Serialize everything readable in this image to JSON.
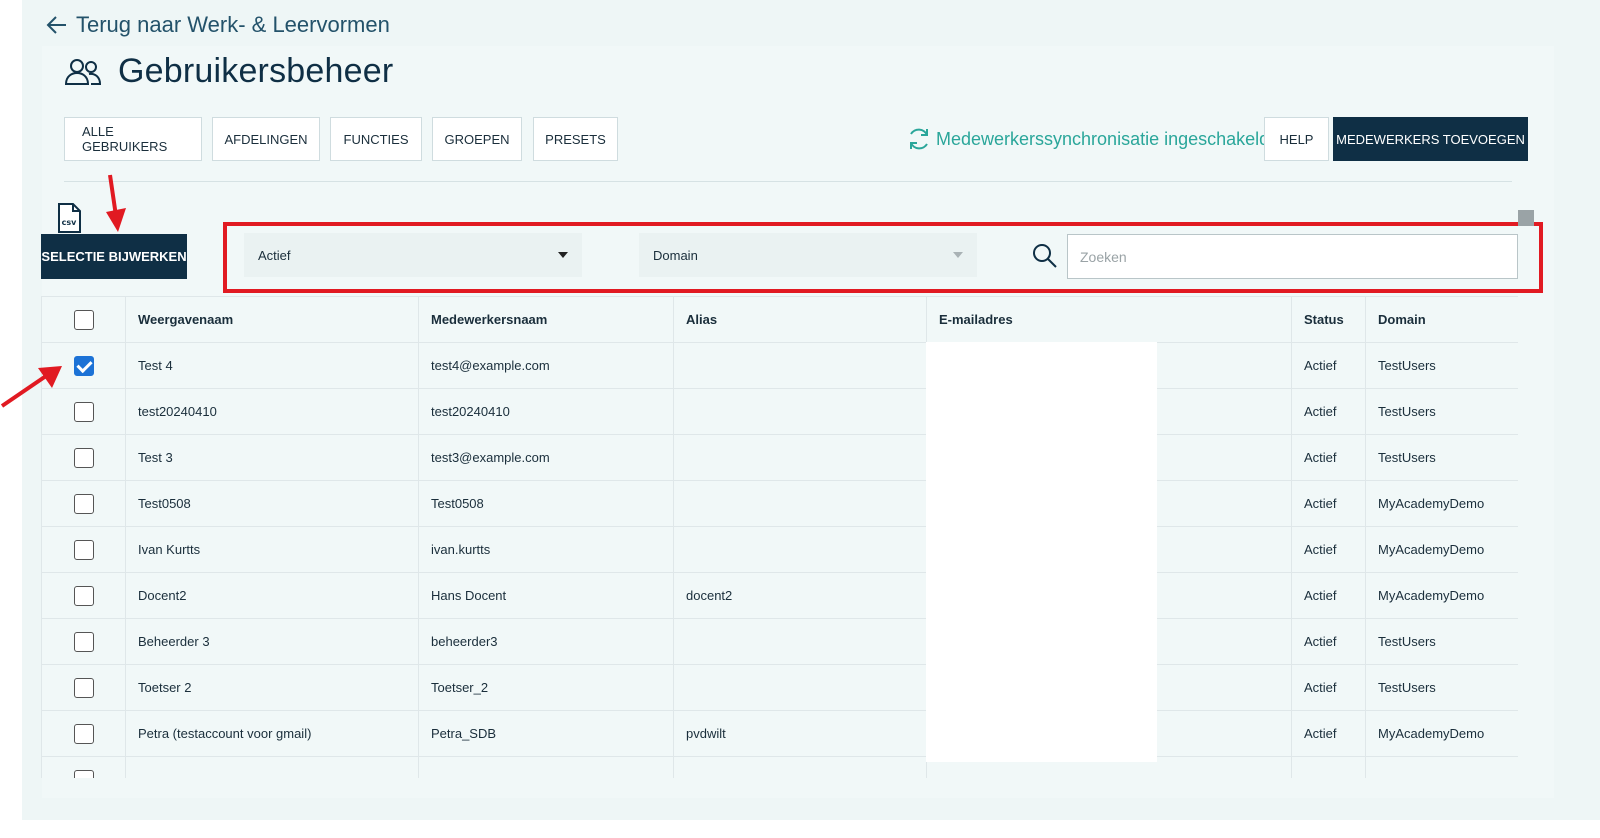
{
  "header": {
    "back_label": "Terug naar Werk- & Leervormen",
    "title": "Gebruikersbeheer"
  },
  "tabs": [
    {
      "label": "ALLE GEBRUIKERS"
    },
    {
      "label": "AFDELINGEN"
    },
    {
      "label": "FUNCTIES"
    },
    {
      "label": "GROEPEN"
    },
    {
      "label": "PRESETS"
    }
  ],
  "sync": {
    "label": "Medewerkerssynchronisatie ingeschakeld",
    "color": "#2aa69a"
  },
  "actions": {
    "help_label": "HELP",
    "add_label": "MEDEWERKERS TOEVOEGEN",
    "selectie_label": "SELECTIE BIJWERKEN",
    "csv_icon_text": "csv"
  },
  "filters": {
    "status_value": "Actief",
    "domain_value": "Domain",
    "search_placeholder": "Zoeken"
  },
  "table": {
    "columns": [
      "Weergavenaam",
      "Medewerkersnaam",
      "Alias",
      "E-mailadres",
      "Status",
      "Domain"
    ],
    "rows": [
      {
        "checked": true,
        "name": "Test 4",
        "user": "test4@example.com",
        "alias": "",
        "status": "Actief",
        "domain": "TestUsers"
      },
      {
        "checked": false,
        "name": "test20240410",
        "user": "test20240410",
        "alias": "",
        "status": "Actief",
        "domain": "TestUsers"
      },
      {
        "checked": false,
        "name": "Test 3",
        "user": "test3@example.com",
        "alias": "",
        "status": "Actief",
        "domain": "TestUsers"
      },
      {
        "checked": false,
        "name": "Test0508",
        "user": "Test0508",
        "alias": "",
        "status": "Actief",
        "domain": "MyAcademyDemo"
      },
      {
        "checked": false,
        "name": "Ivan Kurtts",
        "user": "ivan.kurtts",
        "alias": "",
        "status": "Actief",
        "domain": "MyAcademyDemo"
      },
      {
        "checked": false,
        "name": "Docent2",
        "user": "Hans Docent",
        "alias": "docent2",
        "status": "Actief",
        "domain": "MyAcademyDemo"
      },
      {
        "checked": false,
        "name": "Beheerder 3",
        "user": "beheerder3",
        "alias": "",
        "status": "Actief",
        "domain": "TestUsers"
      },
      {
        "checked": false,
        "name": "Toetser 2",
        "user": "Toetser_2",
        "alias": "",
        "status": "Actief",
        "domain": "TestUsers"
      },
      {
        "checked": false,
        "name": "Petra (testaccount voor gmail)",
        "user": "Petra_SDB",
        "alias": "pvdwilt",
        "status": "Actief",
        "domain": "MyAcademyDemo"
      }
    ]
  },
  "colors": {
    "primary": "#0f2f45",
    "annotation": "#e11a22",
    "checkbox": "#1c72d6"
  }
}
